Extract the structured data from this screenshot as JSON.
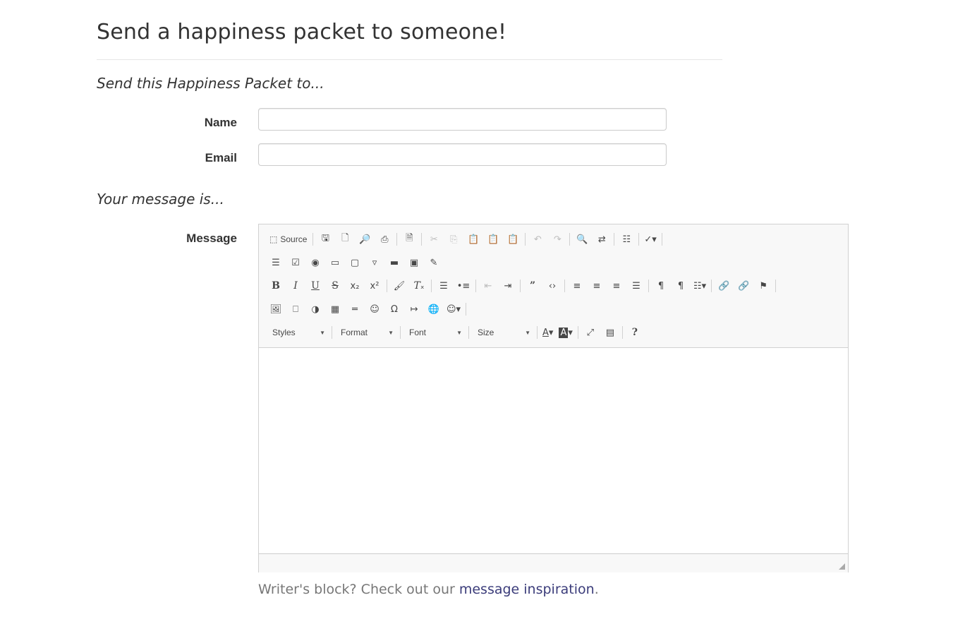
{
  "page": {
    "title": "Send a happiness packet to someone!",
    "section_recipient": "Send this Happiness Packet to...",
    "section_message": "Your message is..."
  },
  "form": {
    "name_label": "Name",
    "name_value": "",
    "email_label": "Email",
    "email_value": "",
    "message_label": "Message"
  },
  "editor": {
    "source_label": "Source",
    "combos": {
      "styles": "Styles",
      "format": "Format",
      "font": "Font",
      "size": "Size"
    },
    "body_text": ""
  },
  "hint": {
    "prefix": "Writer's block? Check out our ",
    "link": "message inspiration",
    "suffix": "."
  },
  "colors": {
    "link": "#3b3c7a",
    "muted_text": "#777777",
    "toolbar_bg": "#f8f8f8"
  }
}
